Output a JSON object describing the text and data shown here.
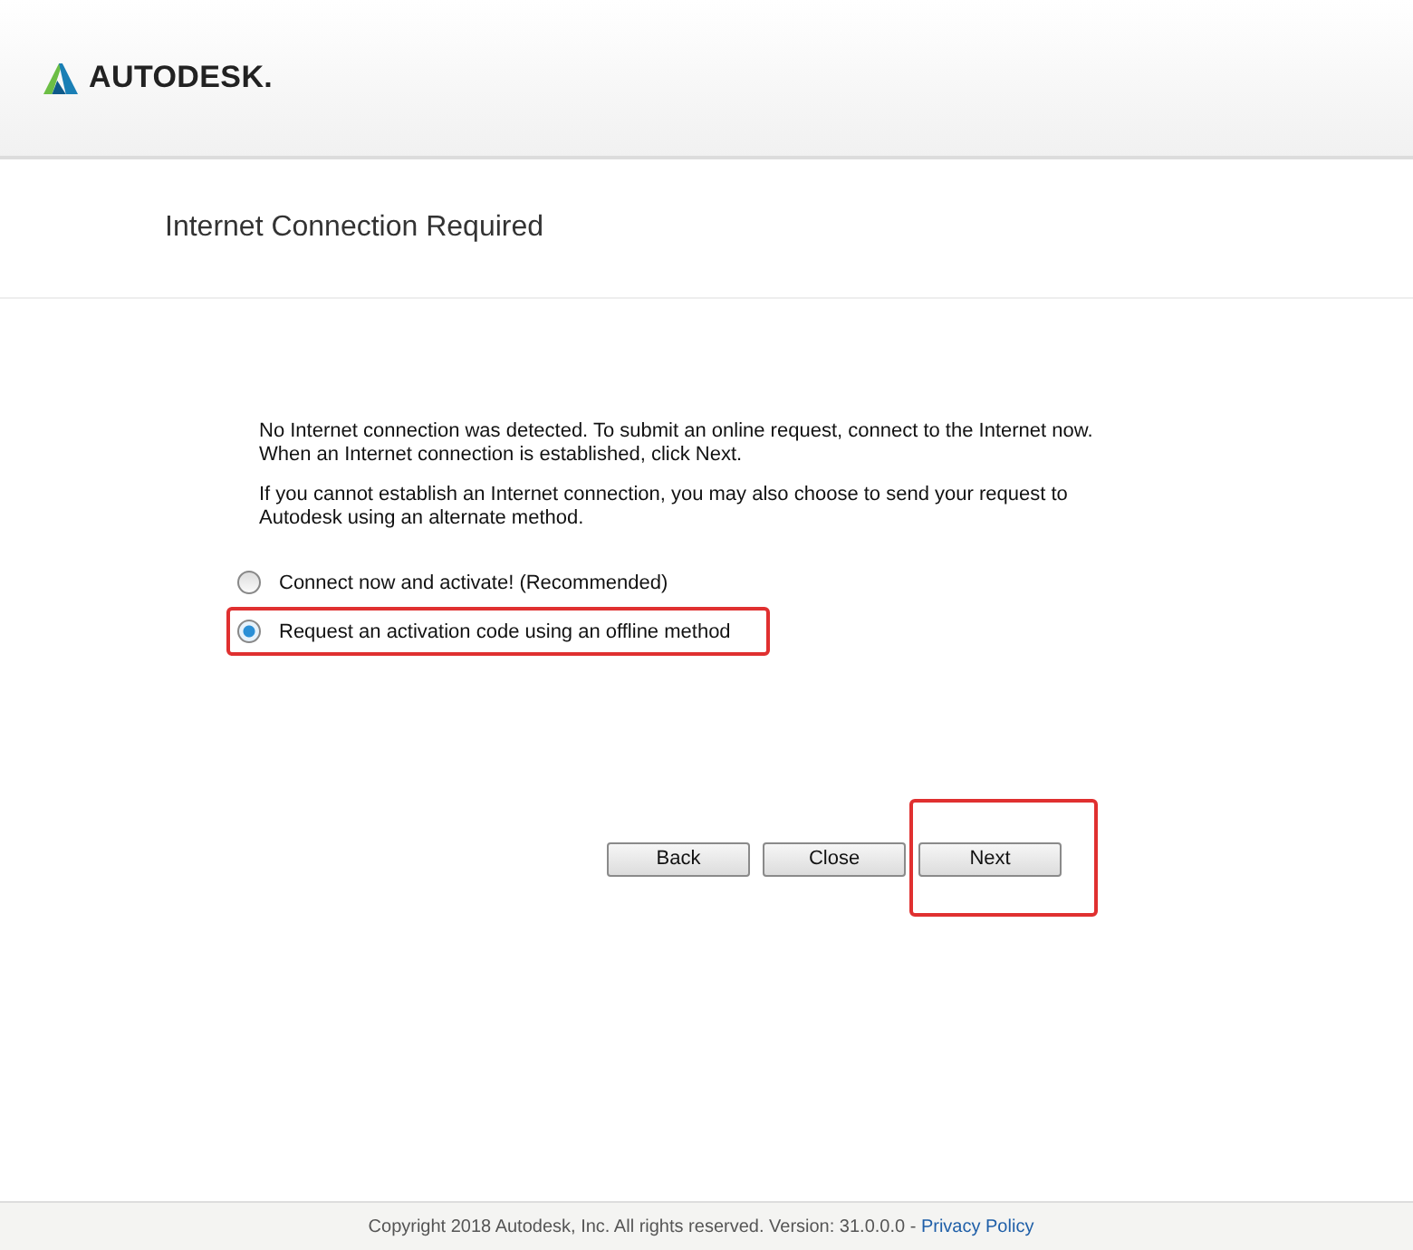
{
  "header": {
    "logo_text": "AUTODESK."
  },
  "title": "Internet Connection Required",
  "paragraphs": [
    "No Internet connection was detected. To submit an online request, connect to the Internet now. When an Internet connection is established, click Next.",
    "If you cannot establish an Internet connection, you may also choose to send your request to Autodesk using an alternate method."
  ],
  "options": [
    {
      "label": "Connect now and activate! (Recommended)",
      "selected": false,
      "highlighted": false
    },
    {
      "label": "Request an activation code using an offline method",
      "selected": true,
      "highlighted": true
    }
  ],
  "buttons": [
    {
      "label": "Back",
      "highlighted": false
    },
    {
      "label": "Close",
      "highlighted": false
    },
    {
      "label": "Next",
      "highlighted": true
    }
  ],
  "footer": {
    "text": "Copyright 2018 Autodesk, Inc. All rights reserved. Version: 31.0.0.0 - ",
    "link": "Privacy Policy"
  }
}
